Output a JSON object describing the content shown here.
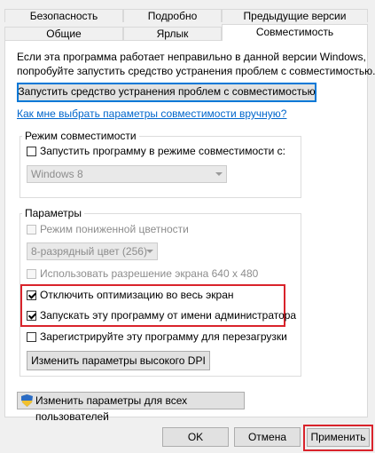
{
  "tabs": {
    "row1": [
      "Безопасность",
      "Подробно",
      "Предыдущие версии"
    ],
    "row2": [
      "Общие",
      "Ярлык",
      "Совместимость"
    ],
    "active": "Совместимость"
  },
  "intro": {
    "line1": "Если эта программа работает неправильно в данной версии Windows,",
    "line2": "попробуйте запустить средство устранения проблем с совместимостью."
  },
  "troubleshoot_button": "Запустить средство устранения проблем с совместимостью",
  "help_link": "Как мне выбрать параметры совместимости вручную?",
  "compat_mode": {
    "legend": "Режим совместимости",
    "checkbox_label": "Запустить программу в режиме совместимости с:",
    "checked": false,
    "select_value": "Windows 8"
  },
  "settings": {
    "legend": "Параметры",
    "reduced_color": {
      "label": "Режим пониженной цветности",
      "checked": false,
      "disabled": true
    },
    "color_select_value": "8-разрядный цвет (256)",
    "res_640": {
      "label": "Использовать разрешение экрана 640 x 480",
      "checked": false,
      "disabled": true
    },
    "disable_fullscreen": {
      "label": "Отключить оптимизацию во весь экран",
      "checked": true
    },
    "run_as_admin": {
      "label": "Запускать эту программу от имени администратора",
      "checked": true
    },
    "register_restart": {
      "label": "Зарегистрируйте эту программу для перезагрузки",
      "checked": false
    },
    "high_dpi_button": "Изменить параметры высокого DPI"
  },
  "all_users_button": "Изменить параметры для всех пользователей",
  "footer": {
    "ok": "OK",
    "cancel": "Отмена",
    "apply": "Применить"
  },
  "colors": {
    "highlight": "#d9232b",
    "link": "#0066cc",
    "focus": "#0078d7"
  }
}
